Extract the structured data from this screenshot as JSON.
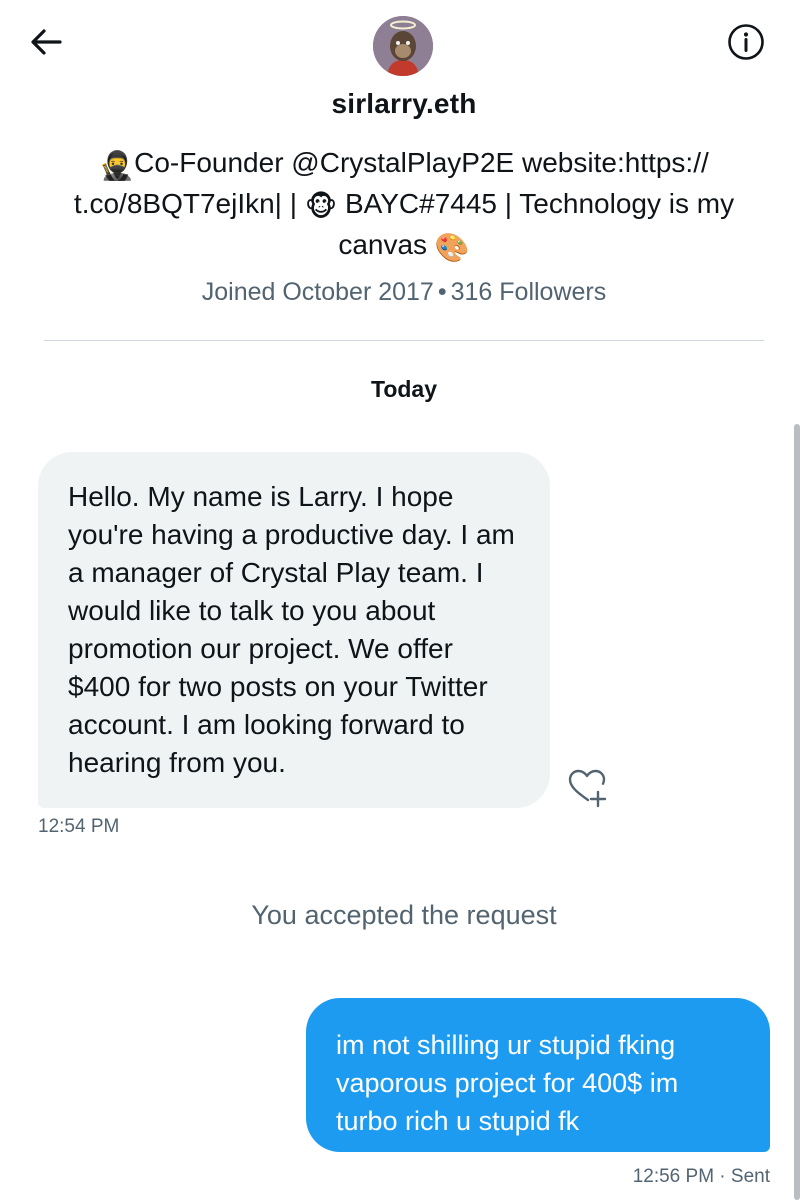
{
  "header": {
    "back_icon": "arrow-left-icon",
    "info_icon": "info-icon",
    "display_name": "sirlarry.eth",
    "avatar_icon": "ape-avatar"
  },
  "profile": {
    "bio_line1": "Co-Founder @CrystalPlayP2E website:https://",
    "bio_line2a": "t.co/8BQT7ejIkn| | ",
    "bio_line2b": " BAYC#7445 | Technology is my",
    "bio_line3": "canvas ",
    "emoji_ninja": "🥷",
    "emoji_monkey": "🐵",
    "emoji_palette": "🎨",
    "joined": "Joined October 2017",
    "separator": "•",
    "followers": "316 Followers"
  },
  "conversation": {
    "day_label": "Today",
    "incoming": {
      "text": "Hello. My name is Larry. I hope you're having a productive day. I am a manager of Crystal Play team. I would like to talk to you about promotion our project. We offer $400 for two posts on your Twitter account. I am looking forward to hearing from you.",
      "time": "12:54 PM",
      "react_icon": "heart-plus-icon"
    },
    "system_message": "You accepted the request",
    "outgoing": {
      "text": "im not shilling ur stupid fking vaporous project for 400$ im turbo rich u stupid fk",
      "status": "12:56 PM · Sent"
    }
  },
  "colors": {
    "accent": "#1d9bf0",
    "incoming_bubble": "#eff3f4",
    "secondary_text": "#536471"
  }
}
